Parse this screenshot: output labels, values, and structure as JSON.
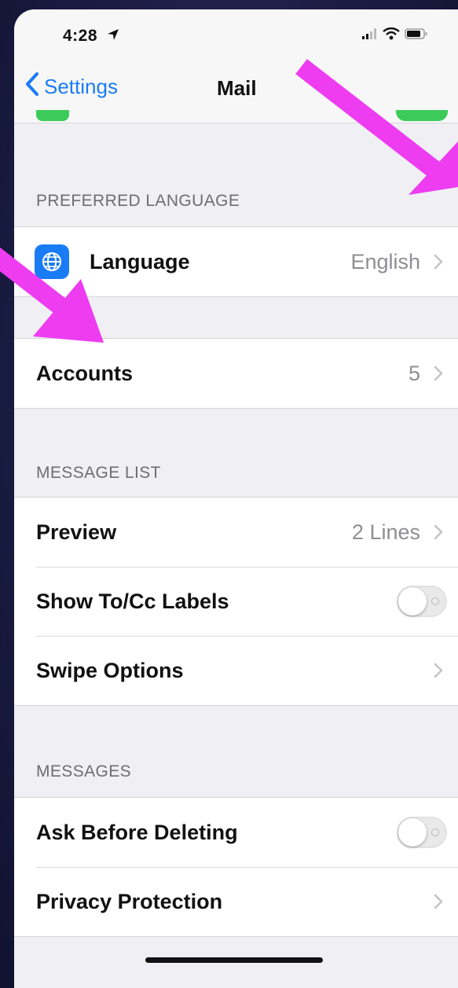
{
  "status_bar": {
    "time": "4:28",
    "location_icon": "location-arrow-icon",
    "signal_icon": "cellular-signal-icon",
    "wifi_icon": "wifi-icon",
    "battery_icon": "battery-icon"
  },
  "nav": {
    "back_label": "Settings",
    "back_icon": "chevron-left-icon",
    "title": "Mail"
  },
  "preferred_language": {
    "header": "PREFERRED LANGUAGE",
    "rows": [
      {
        "label": "Language",
        "value": "English",
        "icon": "globe-icon",
        "accessory": "chevron-right-icon"
      }
    ]
  },
  "accounts": {
    "rows": [
      {
        "label": "Accounts",
        "value": "5",
        "accessory": "chevron-right-icon"
      }
    ]
  },
  "message_list": {
    "header": "MESSAGE LIST",
    "rows": [
      {
        "label": "Preview",
        "value": "2 Lines",
        "accessory": "chevron-right-icon"
      },
      {
        "label": "Show To/Cc Labels",
        "toggle": false
      },
      {
        "label": "Swipe Options",
        "accessory": "chevron-right-icon"
      }
    ]
  },
  "messages": {
    "header": "MESSAGES",
    "rows": [
      {
        "label": "Ask Before Deleting",
        "toggle": false
      },
      {
        "label": "Privacy Protection",
        "accessory": "chevron-right-icon"
      }
    ]
  },
  "colors": {
    "accent": "#1a7cf5",
    "annotation_arrow": "#ee3cf0",
    "toggle_on_peek": "#3ccb5a",
    "background": "#efeff4"
  }
}
